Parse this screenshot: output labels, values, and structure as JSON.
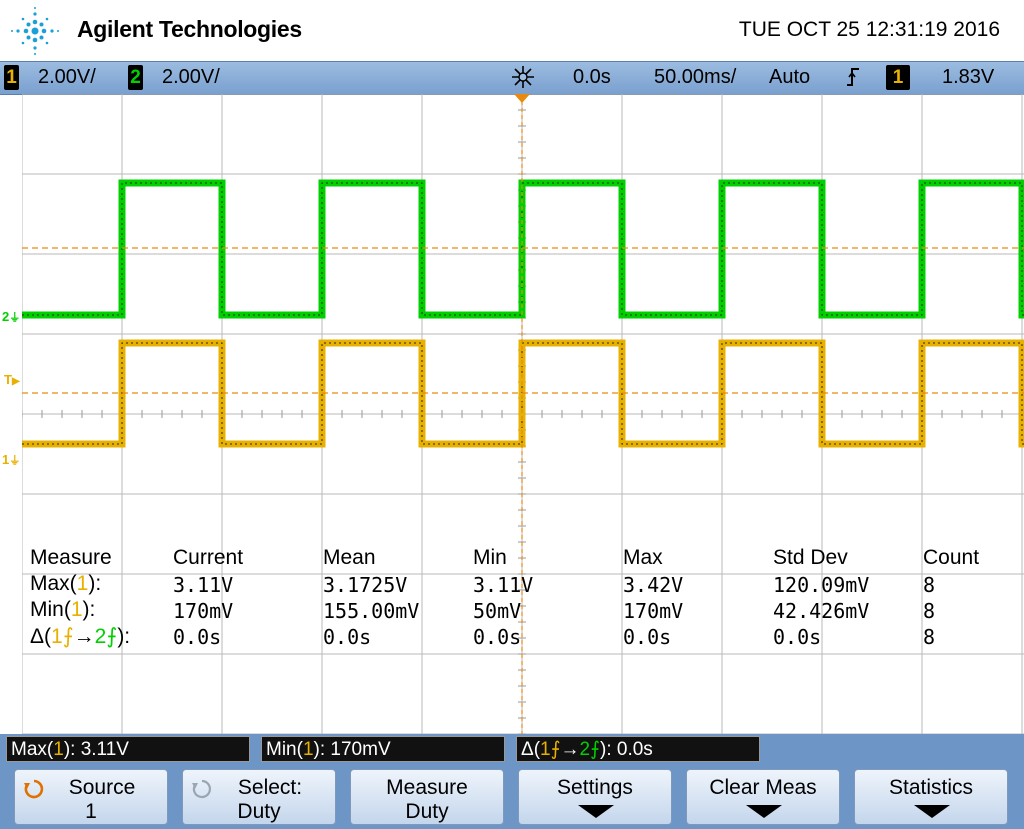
{
  "header": {
    "brand": "Agilent Technologies",
    "datetime": "TUE OCT 25 12:31:19 2016"
  },
  "status": {
    "ch1_num": "1",
    "ch1_scale": "2.00V/",
    "ch2_num": "2",
    "ch2_scale": "2.00V/",
    "delay": "0.0s",
    "timebase": "50.00ms/",
    "trigger_mode": "Auto",
    "trigger_source": "1",
    "trigger_level": "1.83V"
  },
  "indicators": {
    "ch2": "2",
    "trigger": "T",
    "ch1": "1"
  },
  "measurements": {
    "headers": [
      "Measure",
      "Current",
      "Mean",
      "Min",
      "Max",
      "Std Dev",
      "Count"
    ],
    "rows": [
      {
        "pre": "Max(",
        "ch": "1",
        "post": "):",
        "current": "3.11V",
        "mean": "3.1725V",
        "min": "3.11V",
        "max": "3.42V",
        "stddev": "120.09mV",
        "count": "8"
      },
      {
        "pre": "Min(",
        "ch": "1",
        "post": "):",
        "current": "170mV",
        "mean": "155.00mV",
        "min": "50mV",
        "max": "170mV",
        "stddev": "42.426mV",
        "count": "8"
      },
      {
        "pre": "Δ(",
        "chA": "1",
        "arrow": "→",
        "chB": "2",
        "post": "):",
        "current": "0.0s",
        "mean": "0.0s",
        "min": "0.0s",
        "max": "0.0s",
        "stddev": "0.0s",
        "count": "8"
      }
    ]
  },
  "readouts": {
    "r1": {
      "pre": "Max(",
      "ch": "1",
      "post": "): 3.11V"
    },
    "r2": {
      "pre": "Min(",
      "ch": "1",
      "post": "): 170mV"
    },
    "r3": {
      "pre": "Δ(",
      "chA": "1",
      "arrow": "→",
      "chB": "2",
      "post": "): 0.0s"
    }
  },
  "softkeys": [
    {
      "l1": "Source",
      "l2": "1"
    },
    {
      "l1": "Select:",
      "l2": "Duty"
    },
    {
      "l1": "Measure",
      "l2": "Duty"
    },
    {
      "l1": "Settings",
      "l2": ""
    },
    {
      "l1": "Clear Meas",
      "l2": ""
    },
    {
      "l1": "Statistics",
      "l2": ""
    }
  ],
  "colors": {
    "ch1": "#e8b000",
    "ch2": "#00d000",
    "trigger_line": "#e88a10",
    "statusbar": "#8fb2dc",
    "softkey_bar": "#6d96c7"
  },
  "waveforms": {
    "ch1": {
      "high_v": 3.11,
      "low_v": 0.17,
      "period_div": 4,
      "duty": 0.5
    },
    "ch2": {
      "high_v": 3.11,
      "low_v": 0.17,
      "period_div": 4,
      "duty": 0.5
    }
  }
}
